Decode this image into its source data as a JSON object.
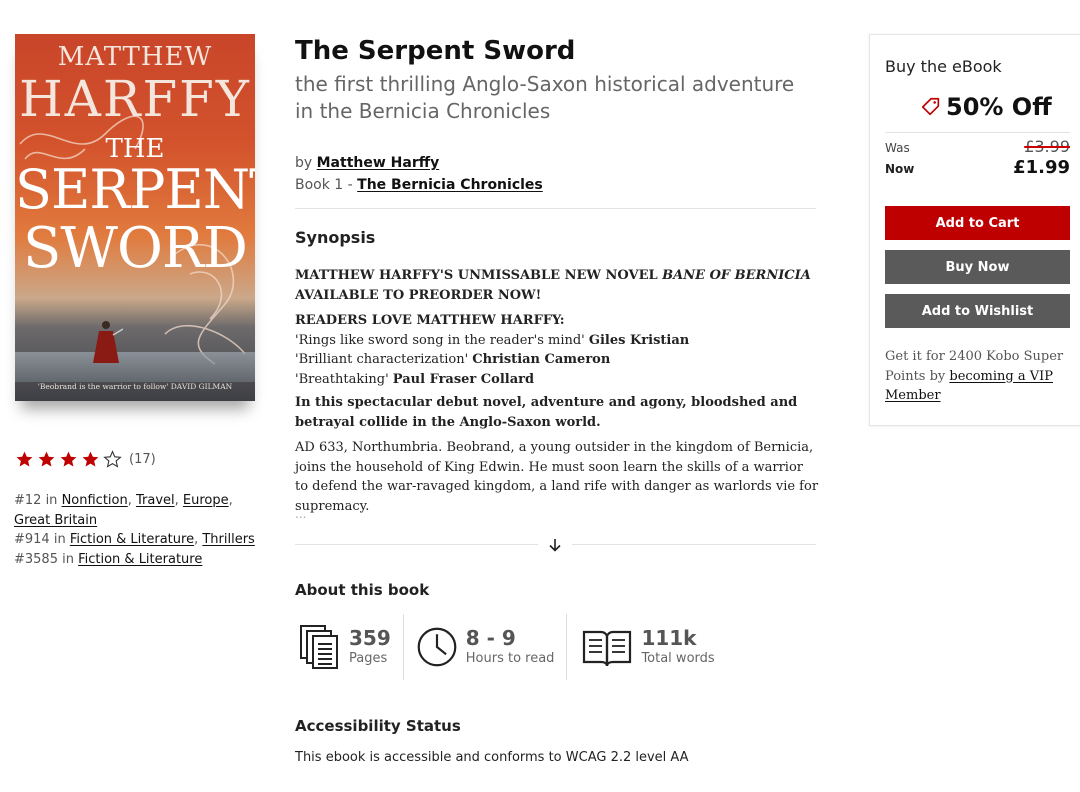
{
  "book": {
    "title": "The Serpent Sword",
    "subtitle": "the first thrilling Anglo-Saxon historical adventure in the Bernicia Chronicles",
    "by_label": "by",
    "author": "Matthew Harffy",
    "series_prefix": "Book 1 - ",
    "series": "The Bernicia Chronicles"
  },
  "cover": {
    "author_line1": "MATTHEW",
    "author_line2": "HARFFY",
    "title_line1": "THE",
    "title_line2": "SERPENT",
    "title_line3": "SWORD",
    "quote": "'Beobrand is the warrior to follow' DAVID GILMAN"
  },
  "rating": {
    "stars_filled": 4,
    "stars_total": 5,
    "count": "(17)",
    "star_color": "#bf0000"
  },
  "ranks": [
    {
      "rank": "#12 in ",
      "cats": [
        "Nonfiction",
        "Travel",
        "Europe",
        "Great Britain"
      ]
    },
    {
      "rank": "#914 in ",
      "cats": [
        "Fiction & Literature",
        "Thrillers"
      ]
    },
    {
      "rank": "#3585 in ",
      "cats": [
        "Fiction & Literature"
      ]
    }
  ],
  "synopsis": {
    "heading": "Synopsis",
    "p1_a": "MATTHEW HARFFY'S UNMISSABLE NEW NOVEL ",
    "p1_b": "BANE OF BERNICIA",
    "p1_c": " AVAILABLE TO PREORDER NOW!",
    "readers_heading": "READERS LOVE MATTHEW HARFFY:",
    "quotes": [
      {
        "q": "'Rings like sword song in the reader's mind' ",
        "who": "Giles Kristian"
      },
      {
        "q": "'Brilliant characterization' ",
        "who": "Christian Cameron"
      },
      {
        "q": "'Breathtaking' ",
        "who": "Paul Fraser Collard"
      }
    ],
    "tagline": "In this spectacular debut novel, adventure and agony, bloodshed and betrayal collide in the Anglo-Saxon world.",
    "body": "AD 633, Northumbria. Beobrand, a young outsider in the kingdom of Bernicia, joins the household of King Edwin. He must soon learn the skills of a warrior to defend the war-ravaged kingdom, a land rife with danger as warlords vie for supremacy.",
    "ellipsis": "..."
  },
  "about": {
    "heading": "About this book",
    "stats": [
      {
        "icon": "pages-icon",
        "value": "359",
        "label": "Pages"
      },
      {
        "icon": "clock-icon",
        "value": "8 - 9",
        "label": "Hours to read"
      },
      {
        "icon": "book-icon",
        "value": "111k",
        "label": "Total words"
      }
    ]
  },
  "accessibility": {
    "heading": "Accessibility Status",
    "text": "This ebook is accessible and conforms to WCAG 2.2 level AA"
  },
  "buy": {
    "heading": "Buy the eBook",
    "discount": "50% Off",
    "was_label": "Was",
    "was_price": "£3.99",
    "now_label": "Now",
    "now_price": "£1.99",
    "add_to_cart": "Add to Cart",
    "buy_now": "Buy Now",
    "add_to_wishlist": "Add to Wishlist",
    "kobo_text": "Get it for 2400 Kobo Super Points by ",
    "kobo_link": "becoming a VIP Member",
    "accent": "#bf0000",
    "grey": "#5a5a5a"
  }
}
